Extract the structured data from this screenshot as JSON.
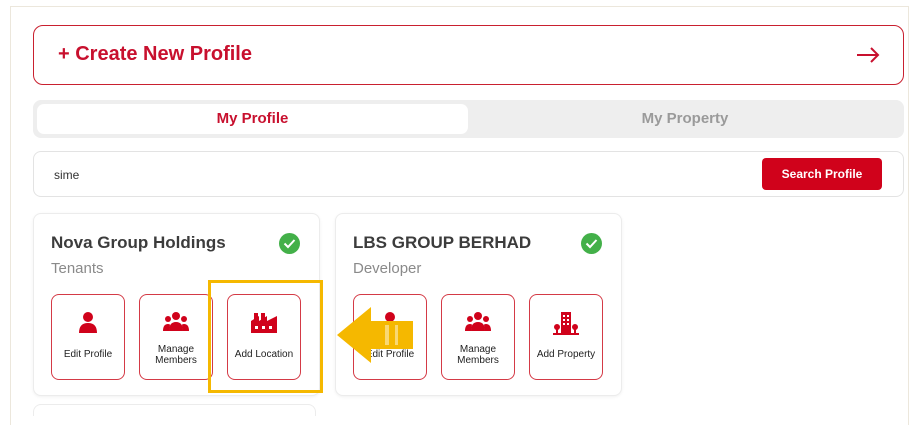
{
  "create_profile": {
    "label": "+ Create New Profile",
    "arrow_icon": "arrow-right-icon"
  },
  "tabs": [
    {
      "label": "My Profile",
      "active": true
    },
    {
      "label": "My Property",
      "active": false
    }
  ],
  "search": {
    "value": "sime",
    "button_label": "Search Profile"
  },
  "cards": [
    {
      "name": "Nova Group Holdings",
      "role": "Tenants",
      "verified_icon": "verified-check-icon",
      "actions": [
        {
          "label": "Edit Profile",
          "icon": "person-icon"
        },
        {
          "label": "Manage Members",
          "icon": "group-icon"
        },
        {
          "label": "Add Location",
          "icon": "factory-icon"
        }
      ]
    },
    {
      "name": "LBS GROUP BERHAD",
      "role": "Developer",
      "verified_icon": "verified-check-icon",
      "actions": [
        {
          "label": "Edit Profile",
          "icon": "person-icon"
        },
        {
          "label": "Manage Members",
          "icon": "group-icon"
        },
        {
          "label": "Add Property",
          "icon": "building-icon"
        }
      ]
    }
  ],
  "colors": {
    "brand_red": "#c8102e",
    "button_red": "#d0021b",
    "verified_green": "#43b049",
    "highlight_yellow": "#f5b800"
  }
}
